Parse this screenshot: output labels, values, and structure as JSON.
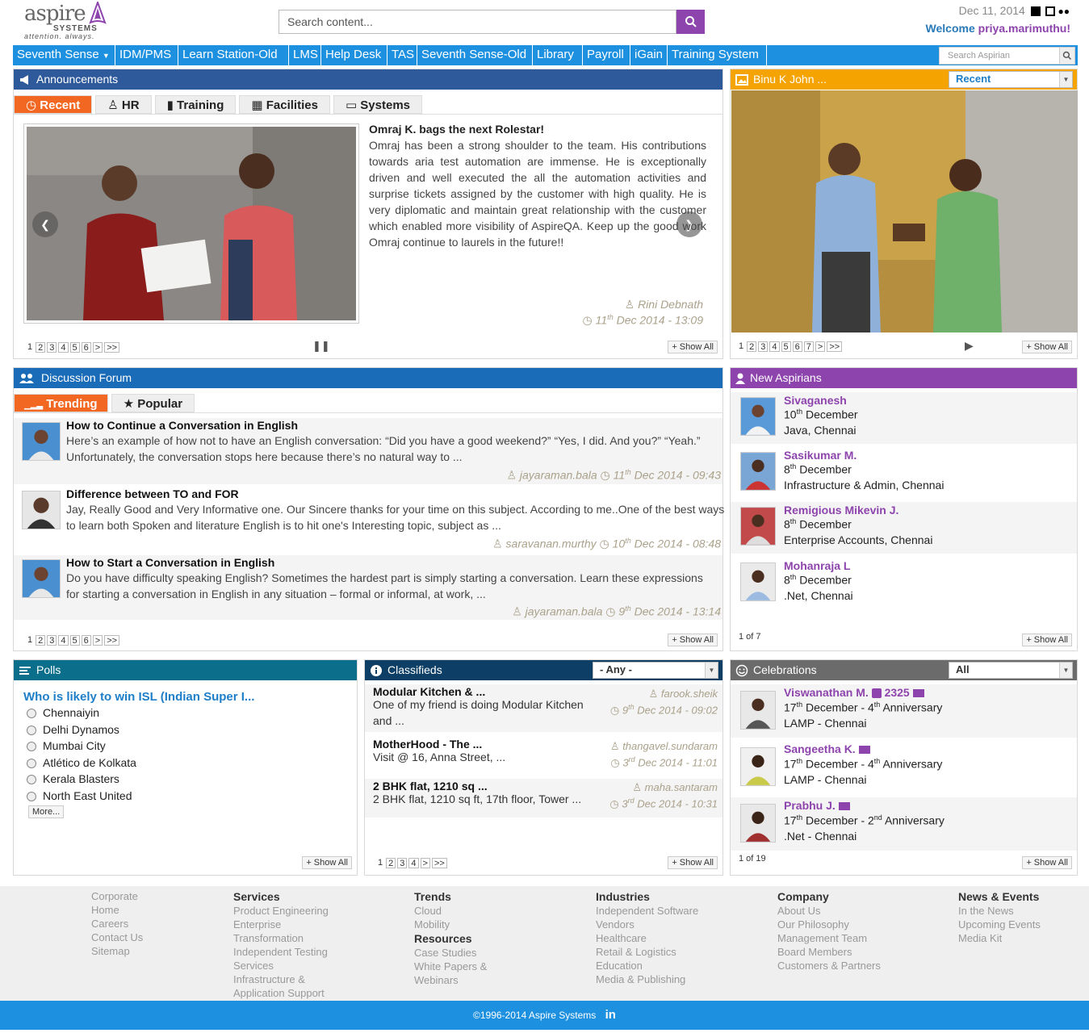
{
  "header": {
    "logo_text": "aspire",
    "logo_sub": "SYSTEMS",
    "logo_tagline": "attention. always.",
    "search_placeholder": "Search content...",
    "date": "Dec 11, 2014",
    "welcome": "Welcome",
    "username": "priya.marimuthu!"
  },
  "nav": {
    "items": [
      "Seventh Sense",
      "IDM/PMS",
      "Learn Station-Old",
      "LMS",
      "Help Desk",
      "TAS",
      "Seventh Sense-Old",
      "Library",
      "Payroll",
      "iGain",
      "Training System"
    ],
    "search_placeholder": "Search Aspirian"
  },
  "announcements": {
    "title": "Announcements",
    "tabs": [
      "Recent",
      "HR",
      "Training",
      "Facilities",
      "Systems"
    ],
    "headline": "Omraj K. bags the next Rolestar!",
    "body": "Omraj has been a strong shoulder to the team. His contributions towards aria test  automation are immense. He is exceptionally driven and well executed the all the automation activities and surprise tickets assigned by the customer with high quality. He is very diplomatic and maintain great relationship with the customer which enabled more visibility of AspireQA. Keep up the good work Omraj continue to laurels in the future!!",
    "author": "Rini Debnath",
    "date_day": "11",
    "date_sup": "th",
    "date_rest": "Dec 2014 - 13:09",
    "pages": [
      "1",
      "2",
      "3",
      "4",
      "5",
      "6",
      ">",
      ">>"
    ],
    "show_all": "Show All"
  },
  "photo_panel": {
    "title": "Binu K John ...",
    "select": "Recent",
    "pages": [
      "1",
      "2",
      "3",
      "4",
      "5",
      "6",
      "7",
      ">",
      ">>"
    ],
    "show_all": "Show All"
  },
  "forum": {
    "title": "Discussion Forum",
    "tabs": [
      "Trending",
      "Popular"
    ],
    "posts": [
      {
        "title": "How to Continue a Conversation in English",
        "body": "Here’s an example of how not to have an English conversation: “Did you have a good weekend?” “Yes, I did. And you?” “Yeah.” Unfortunately, the conversation stops here because there’s no natural way to ...",
        "author": "jayaraman.bala",
        "day": "11",
        "sup": "th",
        "rest": "Dec 2014 - 09:43"
      },
      {
        "title": "Difference between TO and FOR",
        "body": "Jay, Really Good and Very Informative one. Our Sincere thanks for your time on this subject. According to me..One of the best ways to learn both Spoken and literature English is to hit one's Interesting topic, subject as ...",
        "author": "saravanan.murthy",
        "day": "10",
        "sup": "th",
        "rest": "Dec 2014 - 08:48"
      },
      {
        "title": "How to Start a Conversation in English",
        "body": "Do you have difficulty speaking English? Sometimes the hardest part is simply starting a conversation. Learn these expressions for starting a conversation in English in any situation – formal or informal, at work, ...",
        "author": "jayaraman.bala",
        "day": "9",
        "sup": "th",
        "rest": "Dec 2014 - 13:14"
      }
    ],
    "pages": [
      "1",
      "2",
      "3",
      "4",
      "5",
      "6",
      ">",
      ">>"
    ],
    "show_all": "Show All"
  },
  "new_aspirians": {
    "title": "New Aspirians",
    "people": [
      {
        "name": "Sivaganesh",
        "day": "10",
        "sup": "th",
        "rest": "December",
        "dept": "Java, Chennai"
      },
      {
        "name": "Sasikumar M.",
        "day": "8",
        "sup": "th",
        "rest": "December",
        "dept": "Infrastructure & Admin, Chennai"
      },
      {
        "name": "Remigious Mikevin J.",
        "day": "8",
        "sup": "th",
        "rest": "December",
        "dept": "Enterprise Accounts, Chennai"
      },
      {
        "name": "Mohanraja L",
        "day": "8",
        "sup": "th",
        "rest": "December",
        "dept": ".Net, Chennai"
      }
    ],
    "count": "1 of 7",
    "show_all": "Show All"
  },
  "polls": {
    "title": "Polls",
    "question": "Who is likely to win ISL (Indian Super I...",
    "options": [
      "Chennaiyin",
      "Delhi Dynamos",
      "Mumbai City",
      "Atlético de Kolkata",
      "Kerala Blasters",
      "North East United"
    ],
    "more": "More...",
    "show_all": "Show All"
  },
  "classifieds": {
    "title": "Classifieds",
    "select": "- Any -",
    "items": [
      {
        "title": "Modular Kitchen & ...",
        "body1": "One of my friend is doing Modular Kitchen",
        "body2": "and ...",
        "author": "farook.sheik",
        "day": "9",
        "sup": "th",
        "rest": "Dec 2014 - 09:02"
      },
      {
        "title": "MotherHood - The ...",
        "body1": "Visit @ 16, Anna Street, ...",
        "body2": "",
        "author": "thangavel.sundaram",
        "day": "3",
        "sup": "rd",
        "rest": "Dec 2014 - 11:01"
      },
      {
        "title": "2 BHK flat, 1210 sq ...",
        "body1": "2 BHK flat, 1210 sq ft, 17th floor, Tower ...",
        "body2": "",
        "author": "maha.santaram",
        "day": "3",
        "sup": "rd",
        "rest": "Dec 2014 - 10:31"
      }
    ],
    "pages": [
      "1",
      "2",
      "3",
      "4",
      ">",
      ">>"
    ],
    "show_all": "Show All"
  },
  "celebrations": {
    "title": "Celebrations",
    "select": "All",
    "people": [
      {
        "name": "Viswanathan M.",
        "ext": "2325",
        "day": "17",
        "sup": "th",
        "month": "December - 4",
        "asup": "th",
        "ann": "Anniversary",
        "dept": "LAMP - Chennai"
      },
      {
        "name": "Sangeetha K.",
        "ext": "",
        "day": "17",
        "sup": "th",
        "month": "December - 4",
        "asup": "th",
        "ann": "Anniversary",
        "dept": "LAMP - Chennai"
      },
      {
        "name": "Prabhu J.",
        "ext": "",
        "day": "17",
        "sup": "th",
        "month": "December - 2",
        "asup": "nd",
        "ann": "Anniversary",
        "dept": ".Net - Chennai"
      }
    ],
    "count": "1 of 19",
    "show_all": "Show All"
  },
  "footer": {
    "col1": [
      "Corporate",
      "Home",
      "Careers",
      "Contact Us",
      "Sitemap"
    ],
    "services_title": "Services",
    "services": [
      "Product Engineering",
      "Enterprise",
      "Transformation",
      "Independent Testing",
      "Services",
      "Infrastructure &",
      "Application Support"
    ],
    "trends_title": "Trends",
    "trends": [
      "Cloud",
      "Mobility"
    ],
    "resources_title": "Resources",
    "resources": [
      "Case Studies",
      "White Papers &",
      "Webinars"
    ],
    "industries_title": "Industries",
    "industries": [
      "Independent Software",
      "Vendors",
      "Healthcare",
      "Retail & Logistics",
      "Education",
      "Media & Publishing"
    ],
    "company_title": "Company",
    "company": [
      "About Us",
      "Our Philosophy",
      "Management Team",
      "Board Members",
      "Customers & Partners"
    ],
    "news_title": "News & Events",
    "news": [
      "In the News",
      "Upcoming Events",
      "Media Kit"
    ],
    "copyright": "©1996-2014 Aspire Systems",
    "linkedin": "in"
  },
  "colors": {
    "nav_blue": "#1e90e0",
    "announce_header": "#2e5a9c",
    "photo_header": "#f5a300",
    "forum_header": "#1a6bb8",
    "aspirians_header": "#8e44ad",
    "polls_header": "#0b6f8c",
    "classifieds_header": "#0d3f66",
    "celebrations_header": "#6b6b6b",
    "active_tab": "#f26722"
  }
}
